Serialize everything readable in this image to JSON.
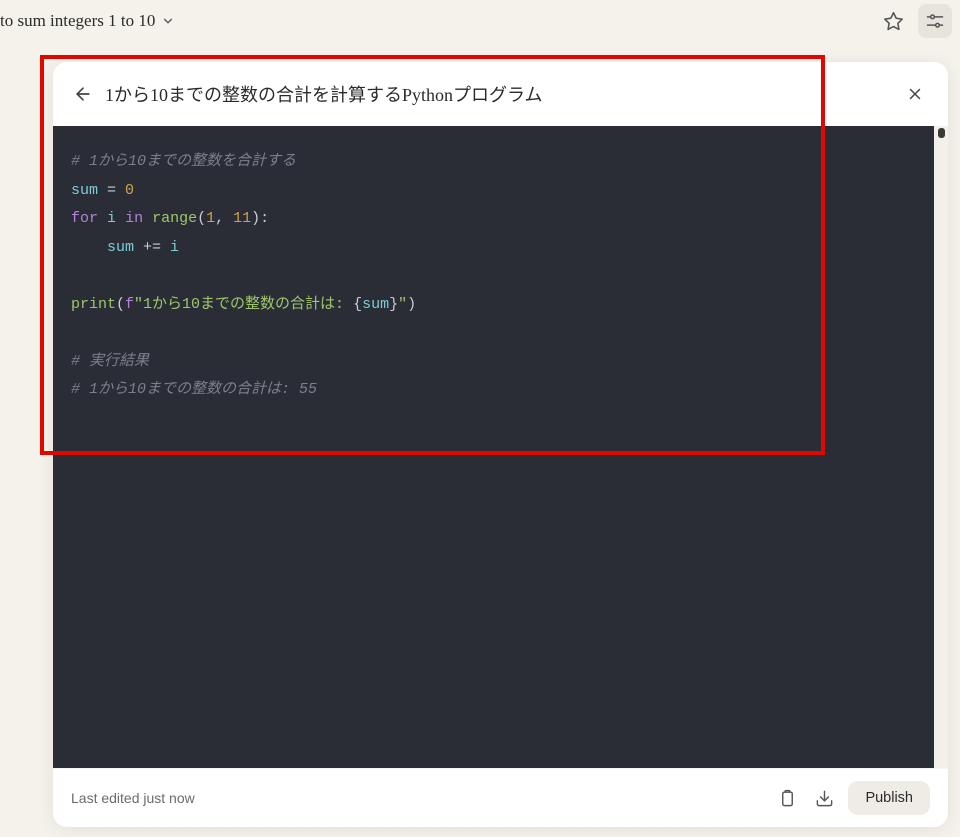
{
  "topbar": {
    "title": "to sum integers 1 to 10"
  },
  "panel": {
    "title": "1から10までの整数の合計を計算するPythonプログラム",
    "footer_status": "Last edited just now",
    "publish_label": "Publish"
  },
  "code": {
    "c1": "# 1から10までの整数を合計する",
    "sum_var": "sum",
    "eq": " = ",
    "zero": "0",
    "for_kw": "for",
    "sp": " ",
    "i_var": "i",
    "in_kw": "in",
    "range_fn": "range",
    "lp": "(",
    "one": "1",
    "comma": ", ",
    "eleven": "11",
    "rp_colon": "):",
    "indent": "    ",
    "pluseq": " += ",
    "print_fn": "print",
    "fprefix": "f",
    "str_open": "\"1から10までの整数の合計は: ",
    "lbrace": "{",
    "rbrace": "}",
    "str_close": "\"",
    "rp": ")",
    "c2": "# 実行結果",
    "c3": "# 1から10までの整数の合計は: 55"
  }
}
